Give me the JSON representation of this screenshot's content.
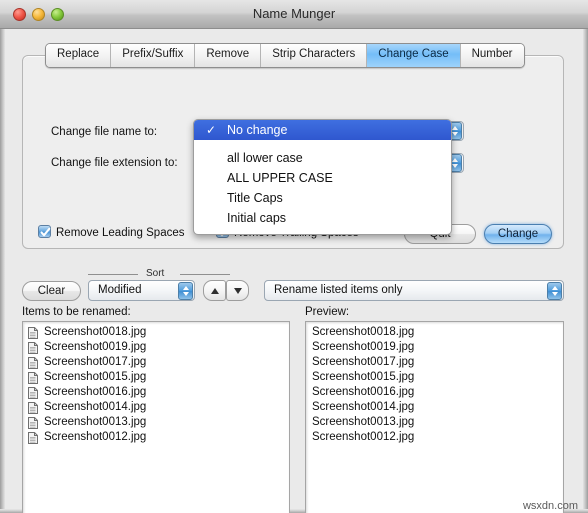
{
  "window": {
    "title": "Name Munger",
    "traffic_lights": [
      "close",
      "minimize",
      "zoom"
    ]
  },
  "tabs": [
    {
      "label": "Replace",
      "selected": false
    },
    {
      "label": "Prefix/Suffix",
      "selected": false
    },
    {
      "label": "Remove",
      "selected": false
    },
    {
      "label": "Strip Characters",
      "selected": false
    },
    {
      "label": "Change Case",
      "selected": true
    },
    {
      "label": "Number",
      "selected": false
    }
  ],
  "change_case_panel": {
    "filename_label": "Change file name to:",
    "fileext_label": "Change file extension to:",
    "filename_popup_value": "No change",
    "fileext_popup_value": "",
    "dropdown_open": true,
    "dropdown_options": [
      {
        "label": "No change",
        "selected": true
      },
      {
        "label": "all lower case",
        "selected": false
      },
      {
        "label": "ALL UPPER CASE",
        "selected": false
      },
      {
        "label": "Title Caps",
        "selected": false
      },
      {
        "label": "Initial caps",
        "selected": false
      }
    ],
    "checkboxes": [
      {
        "label": "Remove Leading Spaces",
        "checked": true
      },
      {
        "label": "Remove Trailing Spaces",
        "checked": true
      }
    ],
    "quit_button": "Quit",
    "change_button": "Change"
  },
  "controls": {
    "clear_button": "Clear",
    "sort_caption": "Sort",
    "sort_value": "Modified",
    "sort_asc_icon": "triangle-up-icon",
    "sort_desc_icon": "triangle-down-icon",
    "scope_value": "Rename listed items only"
  },
  "lists": {
    "items_caption": "Items to be renamed:",
    "preview_caption": "Preview:",
    "items": [
      "Screenshot0018.jpg",
      "Screenshot0019.jpg",
      "Screenshot0017.jpg",
      "Screenshot0015.jpg",
      "Screenshot0016.jpg",
      "Screenshot0014.jpg",
      "Screenshot0013.jpg",
      "Screenshot0012.jpg"
    ],
    "preview": [
      "Screenshot0018.jpg",
      "Screenshot0019.jpg",
      "Screenshot0017.jpg",
      "Screenshot0015.jpg",
      "Screenshot0016.jpg",
      "Screenshot0014.jpg",
      "Screenshot0013.jpg",
      "Screenshot0012.jpg"
    ]
  },
  "watermark": "wsxdn.com",
  "colors": {
    "selected_tab": "#74bdf8",
    "menu_highlight": "#2f57cf",
    "default_button": "#71b2ec",
    "checkbox": "#4a93d4",
    "window_bg": "#eaeaea"
  }
}
